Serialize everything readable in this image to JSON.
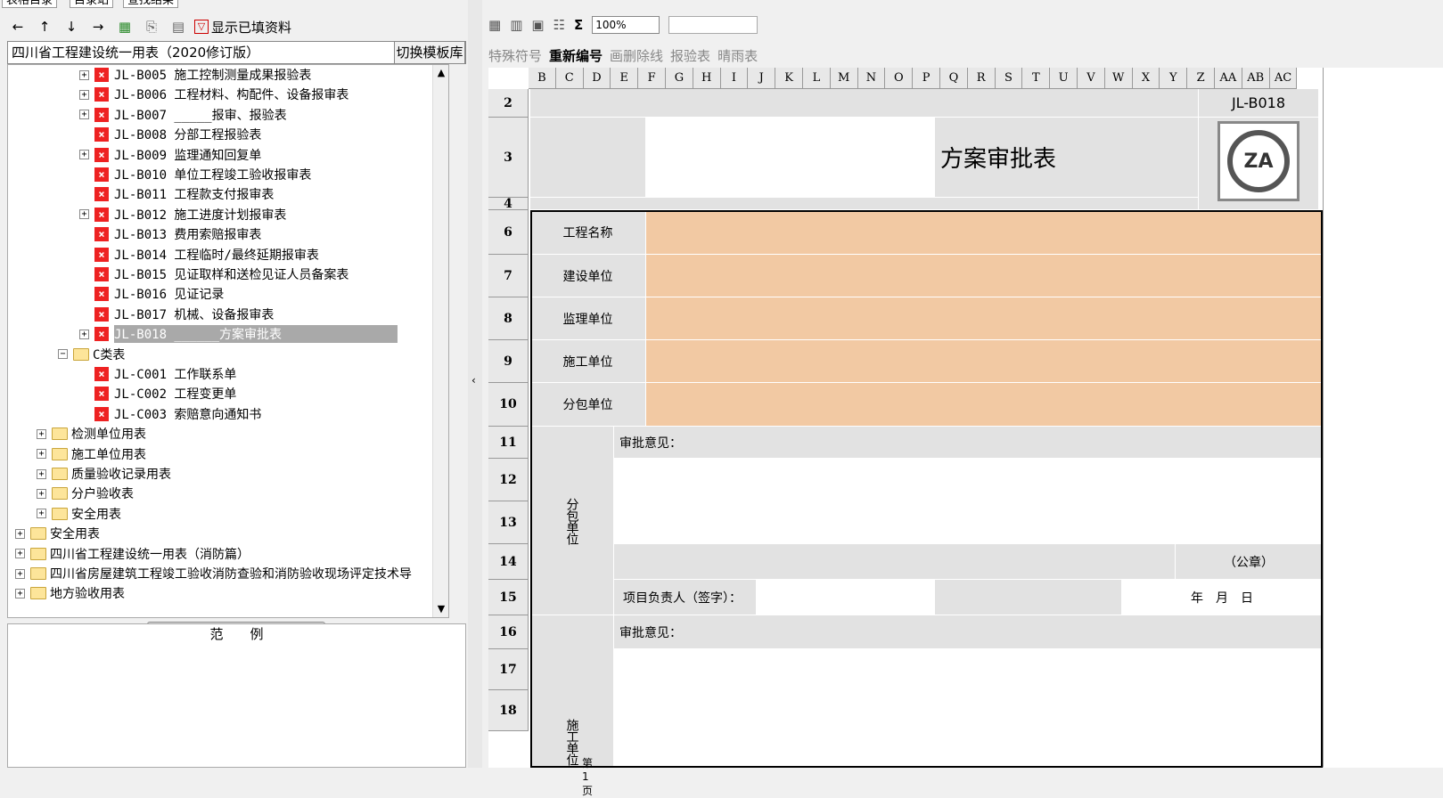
{
  "left": {
    "tabs": [
      "表格目录",
      "目录站",
      "查找结果"
    ],
    "filter_label": "显示已填资料",
    "template_name": "四川省工程建设统一用表（2020修订版）",
    "switch_button": "切换模板库",
    "tree": [
      {
        "indent": 3,
        "expand": "+",
        "type": "doc",
        "text": "JL-B005 施工控制测量成果报验表"
      },
      {
        "indent": 3,
        "expand": "+",
        "type": "doc",
        "text": "JL-B006 工程材料、构配件、设备报审表"
      },
      {
        "indent": 3,
        "expand": "+",
        "type": "doc",
        "text": "JL-B007 _____报审、报验表"
      },
      {
        "indent": 3,
        "expand": "",
        "type": "doc",
        "text": "JL-B008 分部工程报验表"
      },
      {
        "indent": 3,
        "expand": "+",
        "type": "doc",
        "text": "JL-B009 监理通知回复单"
      },
      {
        "indent": 3,
        "expand": "",
        "type": "doc",
        "text": "JL-B010 单位工程竣工验收报审表"
      },
      {
        "indent": 3,
        "expand": "",
        "type": "doc",
        "text": "JL-B011 工程款支付报审表"
      },
      {
        "indent": 3,
        "expand": "+",
        "type": "doc",
        "text": "JL-B012 施工进度计划报审表"
      },
      {
        "indent": 3,
        "expand": "",
        "type": "doc",
        "text": "JL-B013 费用索赔报审表"
      },
      {
        "indent": 3,
        "expand": "",
        "type": "doc",
        "text": "JL-B014 工程临时/最终延期报审表"
      },
      {
        "indent": 3,
        "expand": "",
        "type": "doc",
        "text": "JL-B015 见证取样和送检见证人员备案表"
      },
      {
        "indent": 3,
        "expand": "",
        "type": "doc",
        "text": "JL-B016 见证记录"
      },
      {
        "indent": 3,
        "expand": "",
        "type": "doc",
        "text": "JL-B017 机械、设备报审表"
      },
      {
        "indent": 3,
        "expand": "+",
        "type": "doc",
        "text": "JL-B018 ______方案审批表",
        "selected": true
      },
      {
        "indent": 2,
        "expand": "-",
        "type": "folder-open",
        "text": "C类表"
      },
      {
        "indent": 3,
        "expand": "",
        "type": "doc",
        "text": "JL-C001 工作联系单"
      },
      {
        "indent": 3,
        "expand": "",
        "type": "doc",
        "text": "JL-C002 工程变更单"
      },
      {
        "indent": 3,
        "expand": "",
        "type": "doc",
        "text": "JL-C003 索赔意向通知书"
      },
      {
        "indent": 1,
        "expand": "+",
        "type": "folder",
        "text": "检测单位用表"
      },
      {
        "indent": 1,
        "expand": "+",
        "type": "folder",
        "text": "施工单位用表"
      },
      {
        "indent": 1,
        "expand": "+",
        "type": "folder",
        "text": "质量验收记录用表"
      },
      {
        "indent": 1,
        "expand": "+",
        "type": "folder",
        "text": "分户验收表"
      },
      {
        "indent": 1,
        "expand": "+",
        "type": "folder",
        "text": "安全用表"
      },
      {
        "indent": 0,
        "expand": "+",
        "type": "folder",
        "text": "安全用表"
      },
      {
        "indent": 0,
        "expand": "+",
        "type": "folder",
        "text": "四川省工程建设统一用表（消防篇）"
      },
      {
        "indent": 0,
        "expand": "+",
        "type": "folder",
        "text": "四川省房屋建筑工程竣工验收消防查验和消防验收现场评定技术导"
      },
      {
        "indent": 0,
        "expand": "+",
        "type": "folder",
        "text": "地方验收用表"
      }
    ],
    "legend_title": "范　　例"
  },
  "toolbar3": {
    "special_symbol": "特殊符号",
    "renumber": "重新编号",
    "strike": "画删除线",
    "report": "报验表",
    "weather": "晴雨表",
    "zoom": "100%"
  },
  "sheet": {
    "columns": [
      "B",
      "C",
      "D",
      "E",
      "F",
      "G",
      "H",
      "I",
      "J",
      "K",
      "L",
      "M",
      "N",
      "O",
      "P",
      "Q",
      "R",
      "S",
      "T",
      "U",
      "V",
      "W",
      "X",
      "Y",
      "Z",
      "AA",
      "AB",
      "AC"
    ],
    "rows": [
      "2",
      "3",
      "4",
      "6",
      "7",
      "8",
      "9",
      "10",
      "11",
      "12",
      "13",
      "14",
      "15",
      "16",
      "17",
      "18"
    ],
    "form_code": "JL-B018",
    "form_title": "方案审批表",
    "fields": [
      "工程名称",
      "建设单位",
      "监理单位",
      "施工单位",
      "分包单位"
    ],
    "section1_label": "分包单位",
    "section2_label": "施工单位",
    "opinion_label": "审批意见：",
    "seal_label": "（公章）",
    "signer_label": "项目负责人（签字）：",
    "date_label": "年　月　日",
    "logo_text": "ZA",
    "sheet_tab": "第1页"
  }
}
